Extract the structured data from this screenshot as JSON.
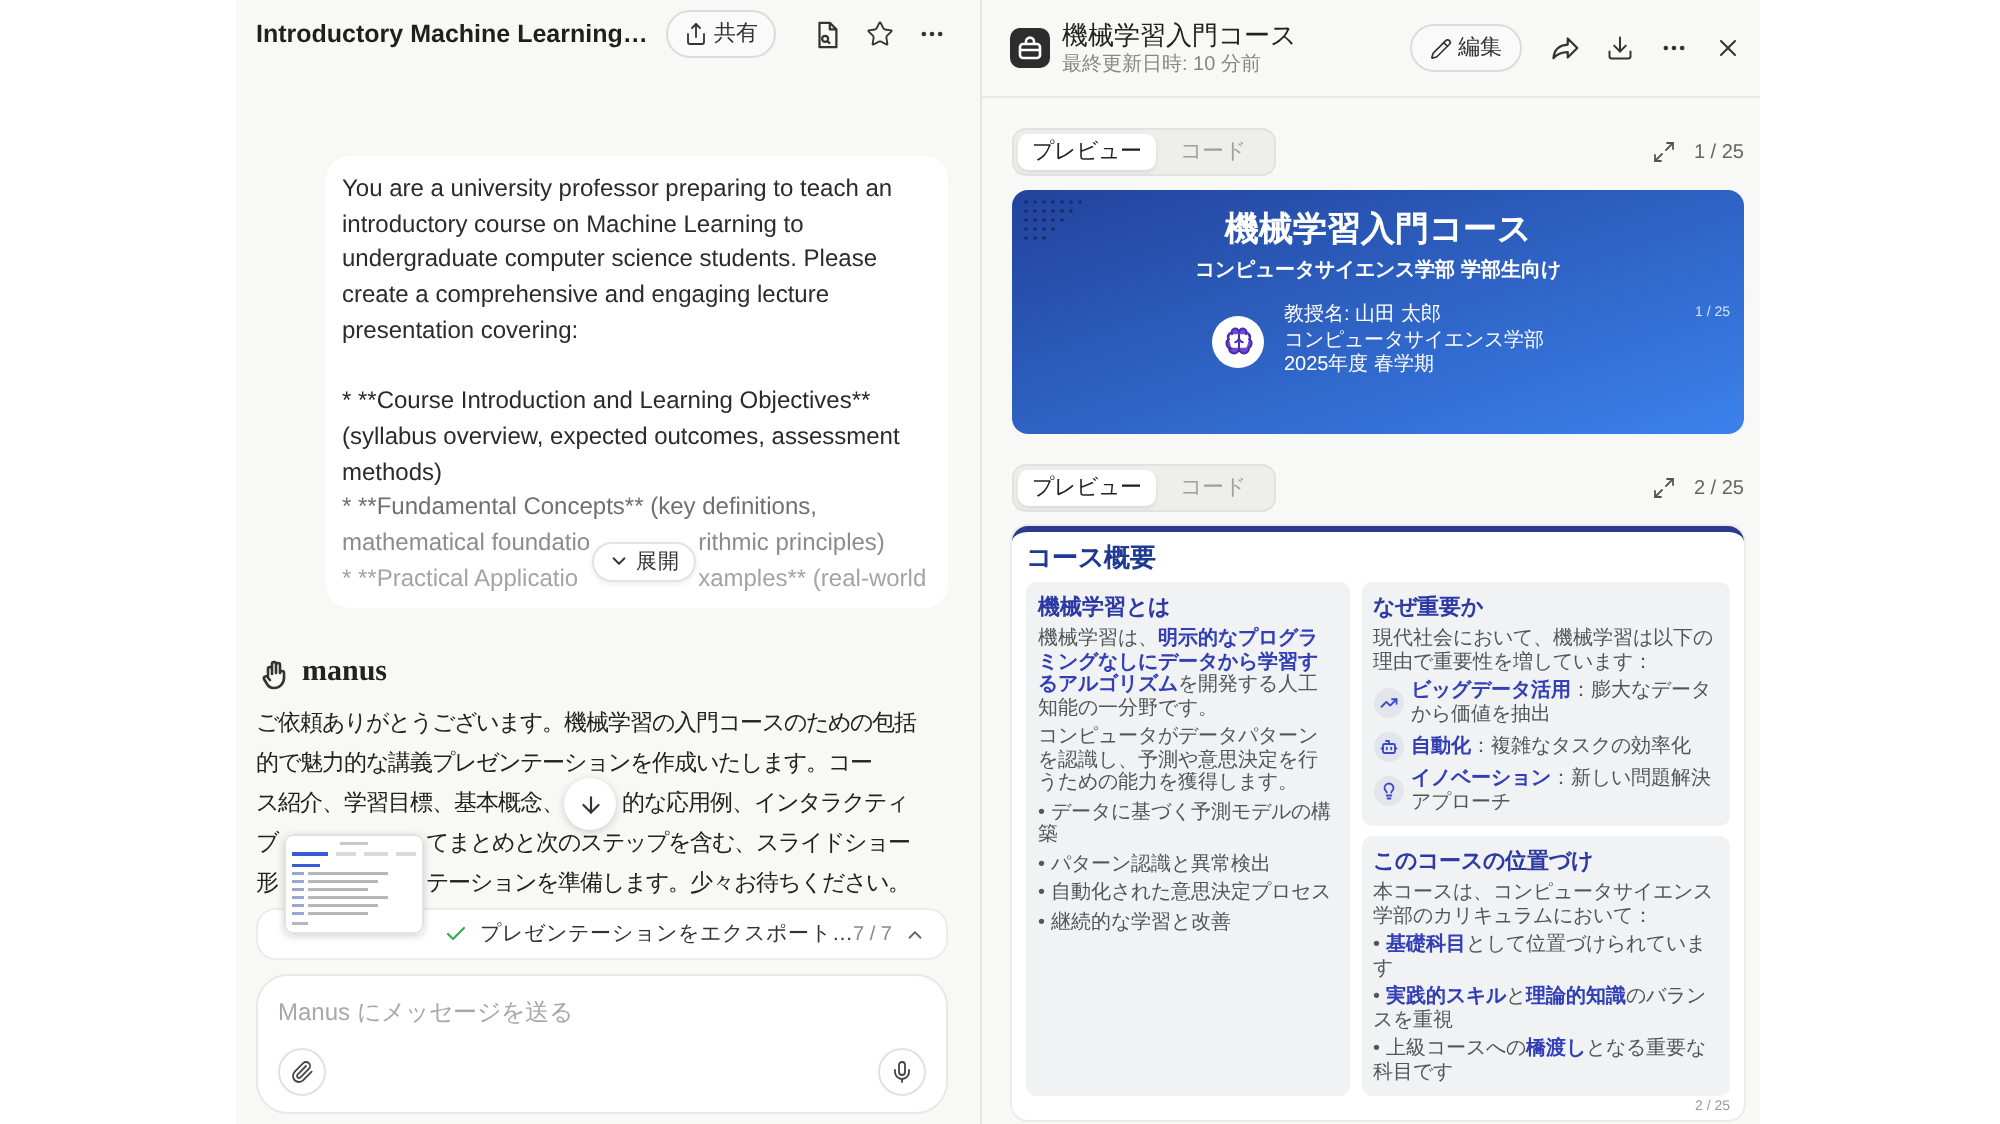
{
  "chat": {
    "title": "Introductory Machine Learning…",
    "share_button": "共有",
    "user_message": {
      "intro": "You are a university professor preparing to teach an introductory course on Machine Learning to undergraduate computer science students. Please create a comprehensive and engaging lecture presentation covering:",
      "items": [
        "* **Course Introduction and Learning Objectives** (syllabus overview, expected outcomes, assessment methods)",
        "* **Fundamental Concepts** (key definitions,"
      ],
      "cut_rows": [
        {
          "left": "mathematical foundatio",
          "right": "rithmic principles)"
        },
        {
          "left": "* **Practical Applicatio",
          "right": "xamples** (real-world"
        }
      ],
      "expand_button": "展開"
    },
    "assistant": {
      "name": "manus",
      "opening": "ご依頼ありがとうございます。機械学習の入門コースのための包括的で魅力的な講義プレゼンテーションを作成いたします。コー",
      "rows": [
        {
          "left": "ス紹介、学習目標、基本概念、",
          "right": "的な応用例、インタラクティ"
        },
        {
          "left": "ブ",
          "right": "てまとめと次のステップを含む、スライドショー"
        },
        {
          "left": "形",
          "right": "テーションを準備します。少々お待ちください。"
        }
      ]
    },
    "task": {
      "done": true,
      "label": "プレゼンテーションをエクスポート…",
      "progress": "7 / 7",
      "expanded": false
    },
    "composer": {
      "placeholder": "Manus にメッセージを送る"
    }
  },
  "viewer": {
    "title": "機械学習入門コース",
    "updated": "最終更新日時: 10 分前",
    "edit_button": "編集",
    "slides": [
      {
        "tabs": [
          {
            "label": "プレビュー",
            "selected": true
          },
          {
            "label": "コード",
            "selected": false
          }
        ],
        "counter": "1 / 25",
        "kind": "title",
        "title": "機械学習入門コース",
        "subtitle": "コンピュータサイエンス学部 学部生向け",
        "presenter": [
          "教授名: 山田 太郎",
          "コンピュータサイエンス学部",
          "2025年度 春学期"
        ],
        "page": "1 / 25"
      },
      {
        "tabs": [
          {
            "label": "プレビュー",
            "selected": true
          },
          {
            "label": "コード",
            "selected": false
          }
        ],
        "counter": "2 / 25",
        "kind": "overview",
        "heading": "コース概要",
        "sections": [
          {
            "title": "機械学習とは",
            "paragraphs": [
              "機械学習は、**明示的なプログラミングなしにデータから学習するアルゴリズム**を開発する人工知能の一分野です。",
              "コンピュータがデータパターンを認識し、予測や意思決定を行うための能力を獲得します。"
            ],
            "bullets": [
              "• データに基づく予測モデルの構築",
              "• パターン認識と異常検出",
              "• 自動化された意思決定プロセス",
              "• 継続的な学習と改善"
            ]
          },
          {
            "title": "なぜ重要か",
            "paragraphs": [
              "現代社会において、機械学習は以下の理由で重要性を増しています："
            ],
            "features": [
              "**ビッグデータ活用**：膨大なデータから価値を抽出",
              "**自動化**：複雑なタスクの効率化",
              "**イノベーション**：新しい問題解決アプローチ"
            ]
          },
          {
            "title": "このコースの位置づけ",
            "paragraphs": [
              "本コースは、コンピュータサイエンス学部のカリキュラムにおいて："
            ],
            "bullets": [
              "• **基礎科目**として位置づけられています",
              "• **実践的スキル**と**理論的知識**のバランスを重視",
              "• 上級コースへの**橋渡し**となる重要な科目です"
            ]
          }
        ],
        "page": "2 / 25"
      }
    ]
  }
}
